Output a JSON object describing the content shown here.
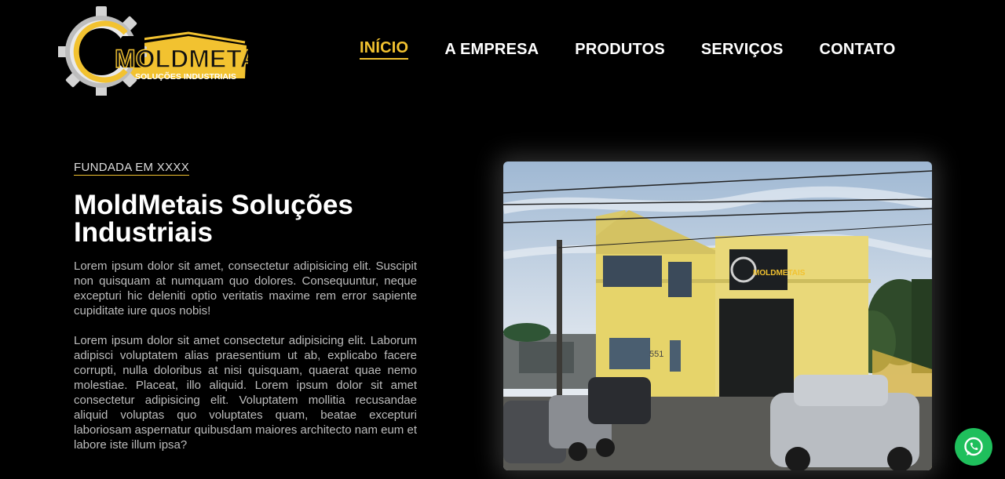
{
  "brand": {
    "name": "MOLDMETAIS",
    "tagline": "SOLUÇÕES INDUSTRIAIS",
    "colors": {
      "accent": "#f2c230",
      "gear": "#c9c9c9",
      "background": "#000000"
    }
  },
  "nav": {
    "items": [
      {
        "label": "INÍCIO",
        "active": true
      },
      {
        "label": "A EMPRESA",
        "active": false
      },
      {
        "label": "PRODUTOS",
        "active": false
      },
      {
        "label": "SERVIÇOS",
        "active": false
      },
      {
        "label": "CONTATO",
        "active": false
      }
    ]
  },
  "hero": {
    "eyebrow": "FUNDADA EM XXXX",
    "title": "MoldMetais Soluções Industriais",
    "paragraphs": [
      "Lorem ipsum dolor sit amet, consectetur adipisicing elit. Suscipit non quisquam at numquam quo dolores. Consequuntur, neque excepturi hic deleniti optio veritatis maxime rem error sapiente cupiditate iure quos nobis!",
      "Lorem ipsum dolor sit amet consectetur adipisicing elit. Laborum adipisci voluptatem alias praesentium ut ab, explicabo facere corrupti, nulla doloribus at nisi quisquam, quaerat quae nemo molestiae. Placeat, illo aliquid. Lorem ipsum dolor sit amet consectetur adipisicing elit. Voluptatem mollitia recusandae aliquid voluptas quo voluptates quam, beatae excepturi laboriosam aspernatur quibusdam maiores architecto nam eum et labore iste illum ipsa?"
    ]
  },
  "photo": {
    "building_number": "551",
    "sign_text": "MOLDMETAIS"
  },
  "whatsapp": {
    "icon": "whatsapp-icon"
  }
}
